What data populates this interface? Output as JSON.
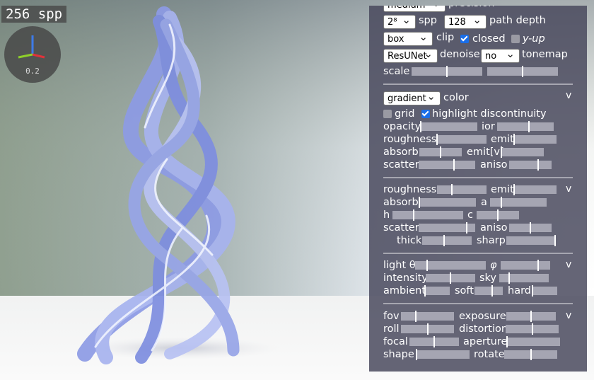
{
  "viewport": {
    "spp_text": "256 spp",
    "gizmo_value": "0.2"
  },
  "panel": {
    "top": {
      "precision_select": "medium",
      "precision_label": "precision",
      "spp_select": "2⁸",
      "spp_label": "spp",
      "depth_select": "128",
      "depth_label": "path depth",
      "clip_select": "box",
      "clip_label": "clip",
      "closed_label": "closed",
      "closed_checked": true,
      "yup_label": "y-up",
      "yup_checked": false,
      "denoiser_select": "ResUNet",
      "denoise_label": "denoise",
      "tonemap_select": "no",
      "tonemap_label": "tonemap",
      "scale_label": "scale",
      "scale_values": [
        0.5,
        0.5
      ]
    },
    "color": {
      "mode_select": "gradient",
      "color_label": "color",
      "collapse": "v",
      "grid_label": "grid",
      "grid_checked": false,
      "highlight_label": "highlight discontinuity",
      "highlight_checked": true,
      "opacity_label": "opacity",
      "opacity_value": 0.0,
      "ior_label": "ior",
      "ior_value": 0.56,
      "roughness_label": "roughness",
      "roughness_value": 0.0,
      "emit_label": "emit",
      "emit_value": 0.0,
      "absorb_label": "absorb",
      "absorb_value": 0.5,
      "emitv_label": "emit[v]",
      "emitv_value": 0.0,
      "scatter_label": "scatter",
      "scatter_value": 0.63,
      "aniso_label": "aniso",
      "aniso_value": 0.68
    },
    "material": {
      "collapse": "v",
      "roughness_label": "roughness",
      "roughness_value": 0.3,
      "emit_label": "emit",
      "emit_value": 0.0,
      "absorb_label": "absorb",
      "absorb_value": 0.0,
      "a_label": "a",
      "a_value": 0.2,
      "h_label": "h",
      "h_value": 0.3,
      "c_label": "c",
      "c_value": 0.5,
      "scatter_label": "scatter",
      "scatter_value": 0.85,
      "aniso_label": "aniso",
      "aniso_value": 0.5,
      "thick_label": "thick",
      "thick_value": 0.44,
      "sharp_label": "sharp",
      "sharp_value": 0.98
    },
    "light": {
      "collapse": "v",
      "theta_label": "light θ",
      "theta_value": 0.17,
      "phi_label": "φ",
      "phi_value": 0.76,
      "intensity_label": "intensity",
      "intensity_value": 0.5,
      "sky_label": "sky",
      "sky_value": 0.2,
      "ambient_label": "ambient",
      "ambient_value": 0.0,
      "soft_label": "soft",
      "soft_value": 0.62,
      "hard_label": "hard",
      "hard_value": 0.0
    },
    "camera": {
      "collapse": "v",
      "fov_label": "fov",
      "fov_value": 0.28,
      "exposure_label": "exposure",
      "exposure_value": 0.5,
      "roll_label": "roll",
      "roll_value": 0.5,
      "distortion_label": "distortion",
      "distortion_value": 0.5,
      "focal_label": "focal",
      "focal_value": 0.5,
      "aperture_label": "aperture",
      "aperture_value": 0.0,
      "shape_label": "shape",
      "shape_value": 0.0,
      "rotate_label": "rotate",
      "rotate_value": 0.5
    }
  }
}
